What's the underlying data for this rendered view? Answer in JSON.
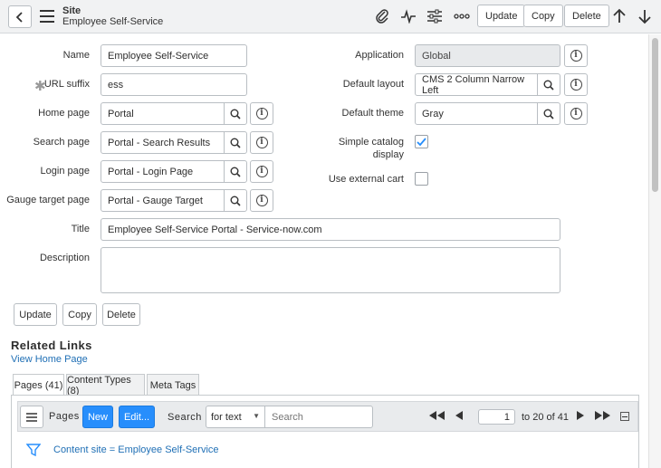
{
  "header": {
    "title": "Site",
    "subtitle": "Employee Self-Service",
    "update_label": "Update",
    "copy_label": "Copy",
    "delete_label": "Delete"
  },
  "form": {
    "name_label": "Name",
    "name_value": "Employee Self-Service",
    "url_suffix_label": "URL suffix",
    "url_suffix_value": "ess",
    "home_page_label": "Home page",
    "home_page_value": "Portal",
    "search_page_label": "Search page",
    "search_page_value": "Portal - Search Results",
    "login_page_label": "Login page",
    "login_page_value": "Portal - Login Page",
    "gauge_target_label": "Gauge target page",
    "gauge_target_value": "Portal - Gauge Target",
    "title_label": "Title",
    "title_value": "Employee Self-Service Portal - Service-now.com",
    "description_label": "Description",
    "description_value": "",
    "application_label": "Application",
    "application_value": "Global",
    "default_layout_label": "Default layout",
    "default_layout_value": "CMS 2 Column Narrow Left",
    "default_theme_label": "Default theme",
    "default_theme_value": "Gray",
    "simple_catalog_label_1": "Simple catalog",
    "simple_catalog_label_2": "display",
    "simple_catalog_checked": true,
    "use_external_cart_label": "Use external cart",
    "use_external_cart_checked": false
  },
  "form_buttons": {
    "update": "Update",
    "copy": "Copy",
    "delete": "Delete"
  },
  "related": {
    "title": "Related Links",
    "view_home_page": "View Home Page"
  },
  "tabs": [
    {
      "label": "Pages (41)",
      "active": true
    },
    {
      "label": "Content Types (8)",
      "active": false
    },
    {
      "label": "Meta Tags",
      "active": false
    }
  ],
  "list": {
    "title": "Pages",
    "new_label": "New",
    "edit_label": "Edit...",
    "search_label": "Search",
    "search_field": "for text",
    "search_placeholder": "Search",
    "page_current": "1",
    "page_range": "to 20 of 41",
    "filter_text": "Content site = Employee Self-Service"
  },
  "colors": {
    "accent": "#278efc",
    "link": "#1f6fb5"
  },
  "icons": [
    "back-icon",
    "menu-icon",
    "paperclip-icon",
    "activity-icon",
    "settings-sliders-icon",
    "more-icon",
    "arrow-up-icon",
    "arrow-down-icon",
    "search-icon",
    "info-icon",
    "check-icon",
    "filter-icon",
    "first-page-icon",
    "prev-page-icon",
    "next-page-icon",
    "last-page-icon",
    "collapse-icon"
  ]
}
